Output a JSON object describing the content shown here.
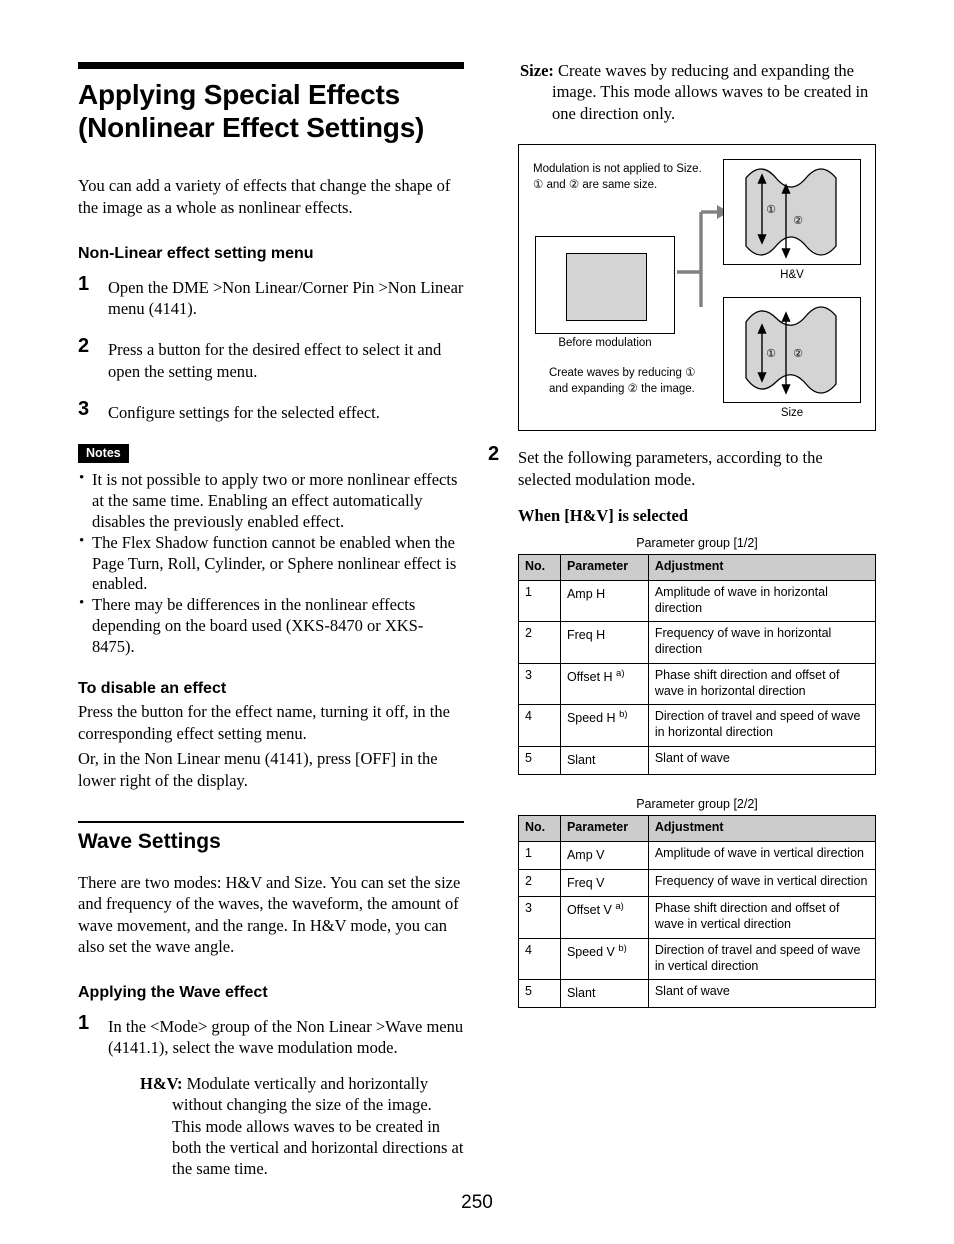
{
  "left": {
    "chapter_title": "Applying Special Effects (Nonlinear Effect Settings)",
    "intro": "You can add a variety of effects that change the shape of the image as a whole as nonlinear effects.",
    "section1_heading": "Non-Linear effect setting menu",
    "steps": [
      {
        "num": "1",
        "text": "Open the DME >Non Linear/Corner Pin >Non Linear menu (4141)."
      },
      {
        "num": "2",
        "text": "Press a button for the desired effect to select it and open the setting menu."
      },
      {
        "num": "3",
        "text": "Configure settings for the selected effect."
      }
    ],
    "notes_label": "Notes",
    "notes": [
      "It is not possible to apply two or more nonlinear effects at the same time. Enabling an effect automatically disables the previously enabled effect.",
      "The Flex Shadow function cannot be enabled when the Page Turn, Roll, Cylinder, or Sphere nonlinear effect is enabled.",
      "There may be differences in the nonlinear effects depending on the board used (XKS-8470 or XKS-8475)."
    ],
    "disable_heading": "To disable an effect",
    "disable_body_1": "Press the button for the effect name, turning it off, in the corresponding effect setting menu.",
    "disable_body_2": "Or, in the Non Linear menu (4141), press [OFF] in the lower right of the display.",
    "wave_heading": "Wave Settings",
    "wave_intro": "There are two modes: H&V and Size. You can set the size and frequency of the waves, the waveform, the amount of wave movement, and the range. In H&V mode, you can also set the wave angle.",
    "applying_heading": "Applying the Wave effect",
    "step1": {
      "num": "1",
      "text": "In the <Mode> group of the Non Linear >Wave menu (4141.1), select the wave modulation mode."
    },
    "hv_term": "H&V:",
    "hv_text": "Modulate vertically and horizontally without changing the size of the image. This mode allows waves to be created in both the vertical and horizontal directions at the same time."
  },
  "right": {
    "size_term": "Size:",
    "size_text": "Create waves by reducing and expanding the image. This mode allows waves to be created in one direction only.",
    "diagram": {
      "caption_top": "Modulation is not applied to Size.\n① and ② are same size.",
      "caption_bottom": "Create waves by reducing ①\nand expanding ② the image.",
      "before_label": "Before modulation",
      "panel_top_label": "H&V",
      "panel_bottom_label": "Size",
      "marker_1": "①",
      "marker_2": "②"
    },
    "step2": {
      "num": "2",
      "text": "Set the following parameters, according to the selected modulation mode."
    },
    "when_hv_heading": "When [H&V] is selected",
    "table1": {
      "caption": "Parameter group [1/2]",
      "headers": [
        "No.",
        "Parameter",
        "Adjustment"
      ],
      "rows": [
        {
          "no": "1",
          "param": "Amp H",
          "fn": "",
          "adj": "Amplitude of wave in horizontal direction"
        },
        {
          "no": "2",
          "param": "Freq H",
          "fn": "",
          "adj": "Frequency of wave in horizontal direction"
        },
        {
          "no": "3",
          "param": "Offset H",
          "fn": "a)",
          "adj": "Phase shift direction and offset of wave in horizontal direction"
        },
        {
          "no": "4",
          "param": "Speed H",
          "fn": "b)",
          "adj": "Direction of travel and speed of wave in horizontal direction"
        },
        {
          "no": "5",
          "param": "Slant",
          "fn": "",
          "adj": "Slant of wave"
        }
      ]
    },
    "table2": {
      "caption": "Parameter group [2/2]",
      "headers": [
        "No.",
        "Parameter",
        "Adjustment"
      ],
      "rows": [
        {
          "no": "1",
          "param": "Amp V",
          "fn": "",
          "adj": "Amplitude of wave in vertical direction"
        },
        {
          "no": "2",
          "param": "Freq V",
          "fn": "",
          "adj": "Frequency of wave in vertical direction"
        },
        {
          "no": "3",
          "param": "Offset V",
          "fn": "a)",
          "adj": "Phase shift direction and offset of wave in vertical direction"
        },
        {
          "no": "4",
          "param": "Speed V",
          "fn": "b)",
          "adj": "Direction of travel and speed of wave in vertical direction"
        },
        {
          "no": "5",
          "param": "Slant",
          "fn": "",
          "adj": "Slant of wave"
        }
      ]
    }
  },
  "page_number": "250",
  "colors": {
    "header_fill": "#cccccc",
    "shape_fill": "#d4d4d4",
    "connector": "#808080",
    "rule": "#000000"
  }
}
